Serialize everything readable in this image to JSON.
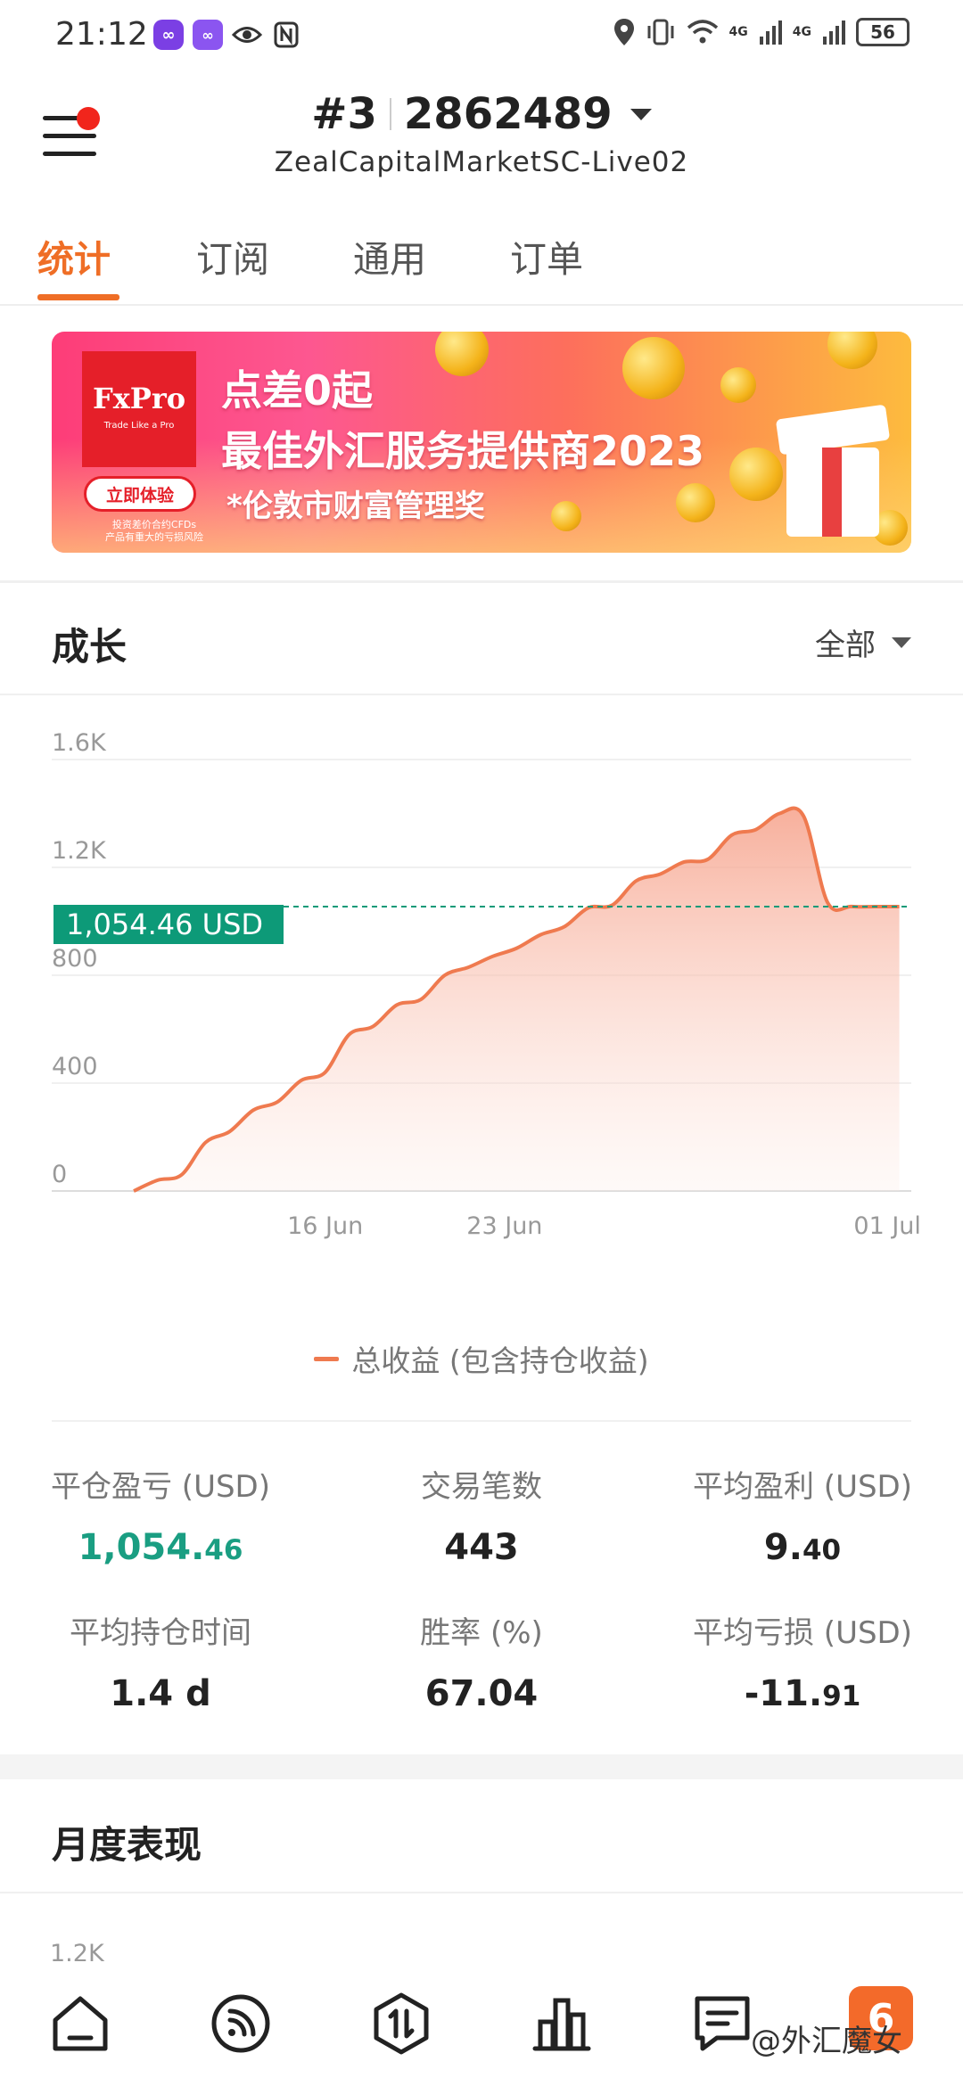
{
  "status_bar": {
    "time": "21:12",
    "app_icons": [
      "infinity-app-icon",
      "app-badge-icon",
      "eye-icon",
      "nfc-icon"
    ],
    "network": "4G",
    "network2": "4G",
    "battery": "56"
  },
  "header": {
    "account_prefix": "#3",
    "account_number": "2862489",
    "server": "ZealCapitalMarketSC-Live02"
  },
  "tabs": [
    {
      "label": "统计",
      "active": true
    },
    {
      "label": "订阅",
      "active": false
    },
    {
      "label": "通用",
      "active": false
    },
    {
      "label": "订单",
      "active": false
    }
  ],
  "banner": {
    "brand": "FxPro",
    "brand_tagline": "Trade Like a Pro",
    "cta": "立即体验",
    "risk_note": "投资差价合约CFDs\n产品有重大的亏损风险",
    "line1": "点差0起",
    "line2": "最佳外汇服务提供商2023",
    "line3": "*伦敦市财富管理奖"
  },
  "growth": {
    "title": "成长",
    "filter": "全部"
  },
  "chart_data": {
    "type": "area",
    "y_ticks": [
      "0",
      "400",
      "800",
      "1.2K",
      "1.6K"
    ],
    "x_ticks": [
      "16 Jun",
      "23 Jun",
      "01 Jul"
    ],
    "ylim": [
      0,
      1600
    ],
    "current_value_label": "1,054.46 USD",
    "current_value": 1054.46,
    "series": [
      {
        "name": "总收益 (包含持仓收益)",
        "color": "#ef7a4f",
        "points": [
          [
            0,
            0
          ],
          [
            1,
            40
          ],
          [
            2,
            60
          ],
          [
            3,
            180
          ],
          [
            4,
            220
          ],
          [
            5,
            300
          ],
          [
            6,
            330
          ],
          [
            7,
            410
          ],
          [
            8,
            440
          ],
          [
            9,
            580
          ],
          [
            10,
            610
          ],
          [
            11,
            690
          ],
          [
            12,
            710
          ],
          [
            13,
            800
          ],
          [
            14,
            830
          ],
          [
            15,
            870
          ],
          [
            16,
            900
          ],
          [
            17,
            950
          ],
          [
            18,
            980
          ],
          [
            19,
            1050
          ],
          [
            20,
            1060
          ],
          [
            21,
            1150
          ],
          [
            22,
            1175
          ],
          [
            23,
            1220
          ],
          [
            24,
            1230
          ],
          [
            25,
            1320
          ],
          [
            26,
            1340
          ],
          [
            27,
            1400
          ],
          [
            28,
            1390
          ],
          [
            29,
            1070
          ],
          [
            30,
            1055
          ],
          [
            31,
            1054.46
          ],
          [
            32,
            1054.46
          ]
        ]
      }
    ],
    "x_tick_positions": [
      8,
      15.5,
      31.5
    ],
    "x_range": [
      0,
      32.5
    ]
  },
  "stats": {
    "close_pl": {
      "label": "平仓盈亏 (USD)",
      "int": "1,054.",
      "dec": "46"
    },
    "trades": {
      "label": "交易笔数",
      "int": "443",
      "dec": ""
    },
    "avg_profit": {
      "label": "平均盈利 (USD)",
      "int": "9.",
      "dec": "40"
    },
    "avg_hold": {
      "label": "平均持仓时间",
      "int": "1.4 d",
      "dec": ""
    },
    "win_rate": {
      "label": "胜率 (%)",
      "int": "67.04",
      "dec": ""
    },
    "avg_loss": {
      "label": "平均亏损 (USD)",
      "int": "-11.",
      "dec": "91"
    }
  },
  "monthly": {
    "title": "月度表现",
    "first_tick": "1.2K"
  },
  "bottom_nav": [
    "home-icon",
    "feed-icon",
    "trade-icon",
    "chart-bar-icon",
    "messages-icon"
  ],
  "watermark": "@外汇魔女"
}
